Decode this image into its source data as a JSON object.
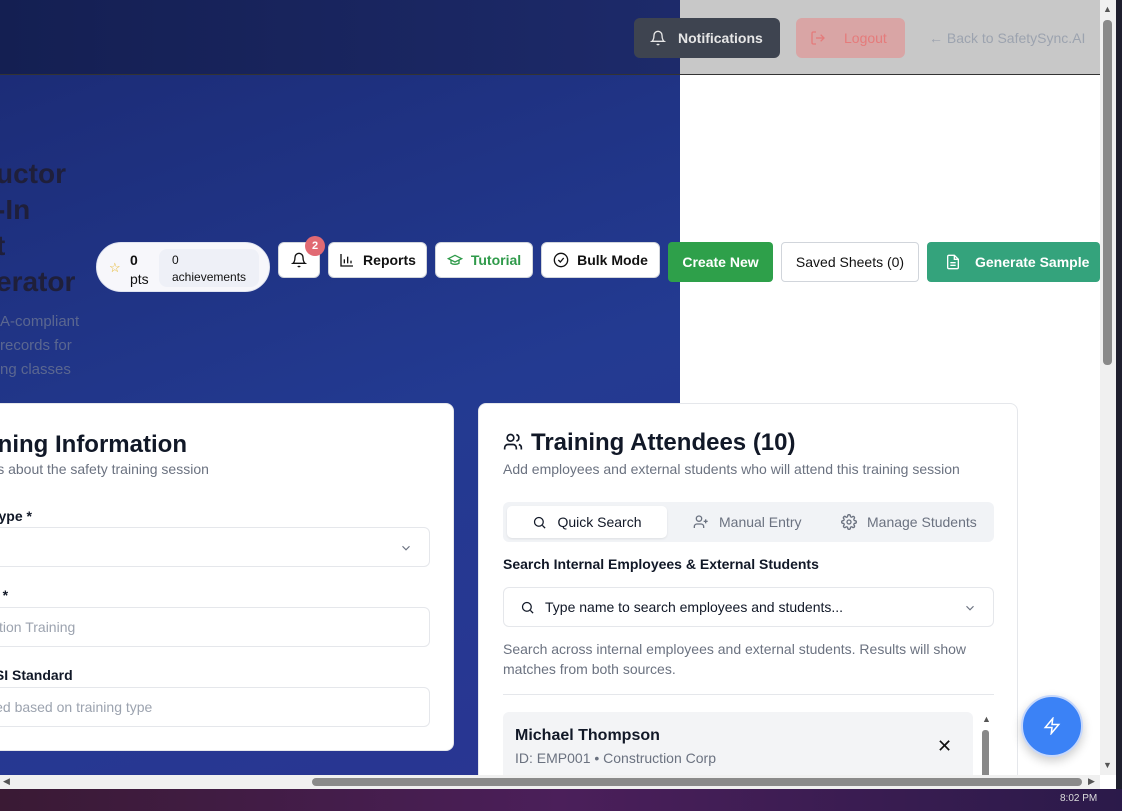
{
  "header": {
    "notifications_label": "Notifications",
    "logout_label": "Logout",
    "back_link": "← Back to SafetySync.AI"
  },
  "hero": {
    "title_lines": [
      "uctor",
      "-In",
      "t",
      "erator"
    ],
    "subtitle_lines": [
      "A-compliant",
      "records for",
      "ng classes"
    ]
  },
  "toolbar": {
    "points_value": "0",
    "points_unit": "pts",
    "achievements_value": "0",
    "achievements_label": "achievements",
    "notification_count": "2",
    "reports_label": "Reports",
    "tutorial_label": "Tutorial",
    "bulk_mode_label": "Bulk Mode",
    "create_new_label": "Create New",
    "saved_sheets_label": "Saved Sheets (0)",
    "generate_sample_label": "Generate Sample"
  },
  "training_info": {
    "title": "ining Information",
    "subtitle": "ils about the safety training session",
    "type_label": "Type *",
    "type_value": "",
    "name_label": "e *",
    "name_placeholder": "ction Training",
    "ansi_label": "ISI Standard",
    "ansi_placeholder": "led based on training type"
  },
  "attendees": {
    "title": "Training Attendees (10)",
    "subtitle": "Add employees and external students who will attend this training session",
    "tabs": [
      "Quick Search",
      "Manual Entry",
      "Manage Students"
    ],
    "search_label": "Search Internal Employees & External Students",
    "search_placeholder": "Type name to search employees and students...",
    "search_help": "Search across internal employees and external students. Results will show matches from both sources.",
    "list": [
      {
        "name": "Michael Thompson",
        "meta": "ID: EMP001 • Construction Corp"
      }
    ]
  },
  "taskbar": {
    "time": "8:02 PM"
  },
  "colors": {
    "hero_gradient_start": "#1b2a73",
    "primary_green": "#2ea04a",
    "teal": "#34a37c",
    "fab_blue": "#3b82f6",
    "badge_red": "#e16a73"
  }
}
